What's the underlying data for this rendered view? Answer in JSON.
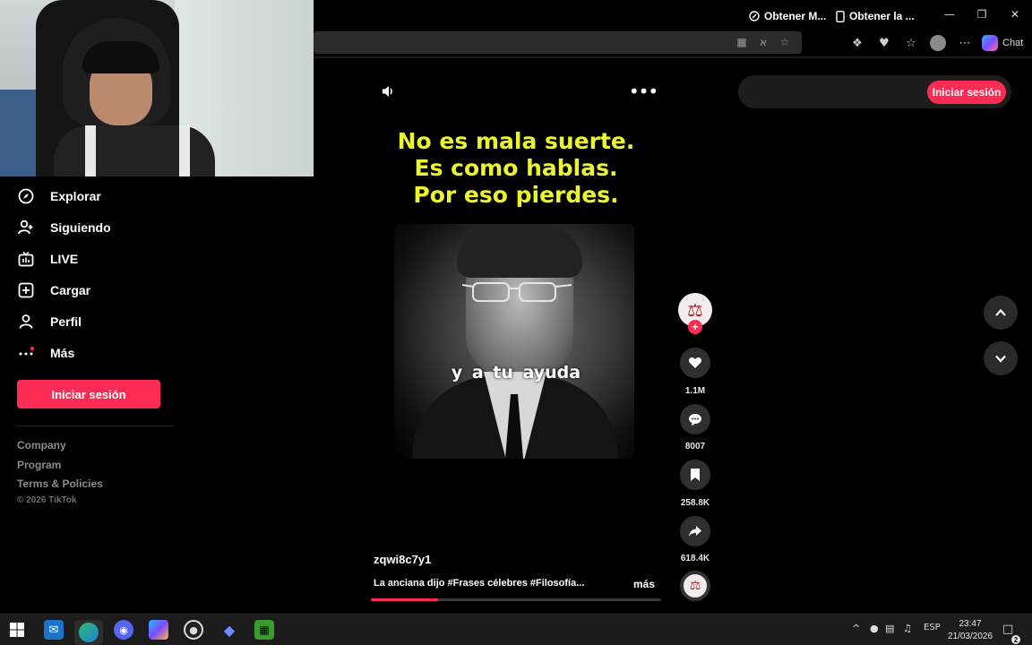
{
  "browser": {
    "copilot_label": "Chat"
  },
  "sidebar": {
    "items": [
      {
        "label": "Explorar",
        "icon": "compass-icon"
      },
      {
        "label": "Siguiendo",
        "icon": "user-follow-icon"
      },
      {
        "label": "LIVE",
        "icon": "live-tv-icon"
      },
      {
        "label": "Cargar",
        "icon": "upload-plus-icon"
      },
      {
        "label": "Perfil",
        "icon": "user-icon"
      },
      {
        "label": "Más",
        "icon": "more-dots-icon"
      }
    ],
    "login_label": "Iniciar sesión",
    "footer_links": [
      "Company",
      "Program",
      "Terms & Policies"
    ],
    "copyright": "© 2026 TikTok"
  },
  "video": {
    "caption_lines": [
      "No es mala suerte.",
      "Es como hablas.",
      "Por eso pierdes."
    ],
    "subtitle": "y a tu ayuda",
    "username": "zqwi8c7y1",
    "description": "La anciana dijo #Frases célebres #Filosofía...",
    "more_label": "más",
    "progress": 0.23
  },
  "actions": {
    "likes": "1.1M",
    "comments": "8007",
    "saves": "258.8K",
    "shares": "618.4K"
  },
  "top_pill": {
    "link1": "Obtener M...",
    "link2": "Obtener la ...",
    "login_label": "Iniciar sesión"
  },
  "taskbar": {
    "language": "ESP",
    "time": "23:47",
    "date": "21/03/2026",
    "notifications": "2"
  },
  "colors": {
    "accent": "#fe2c55",
    "caption_yellow": "#ecf52b",
    "background": "#000000"
  }
}
